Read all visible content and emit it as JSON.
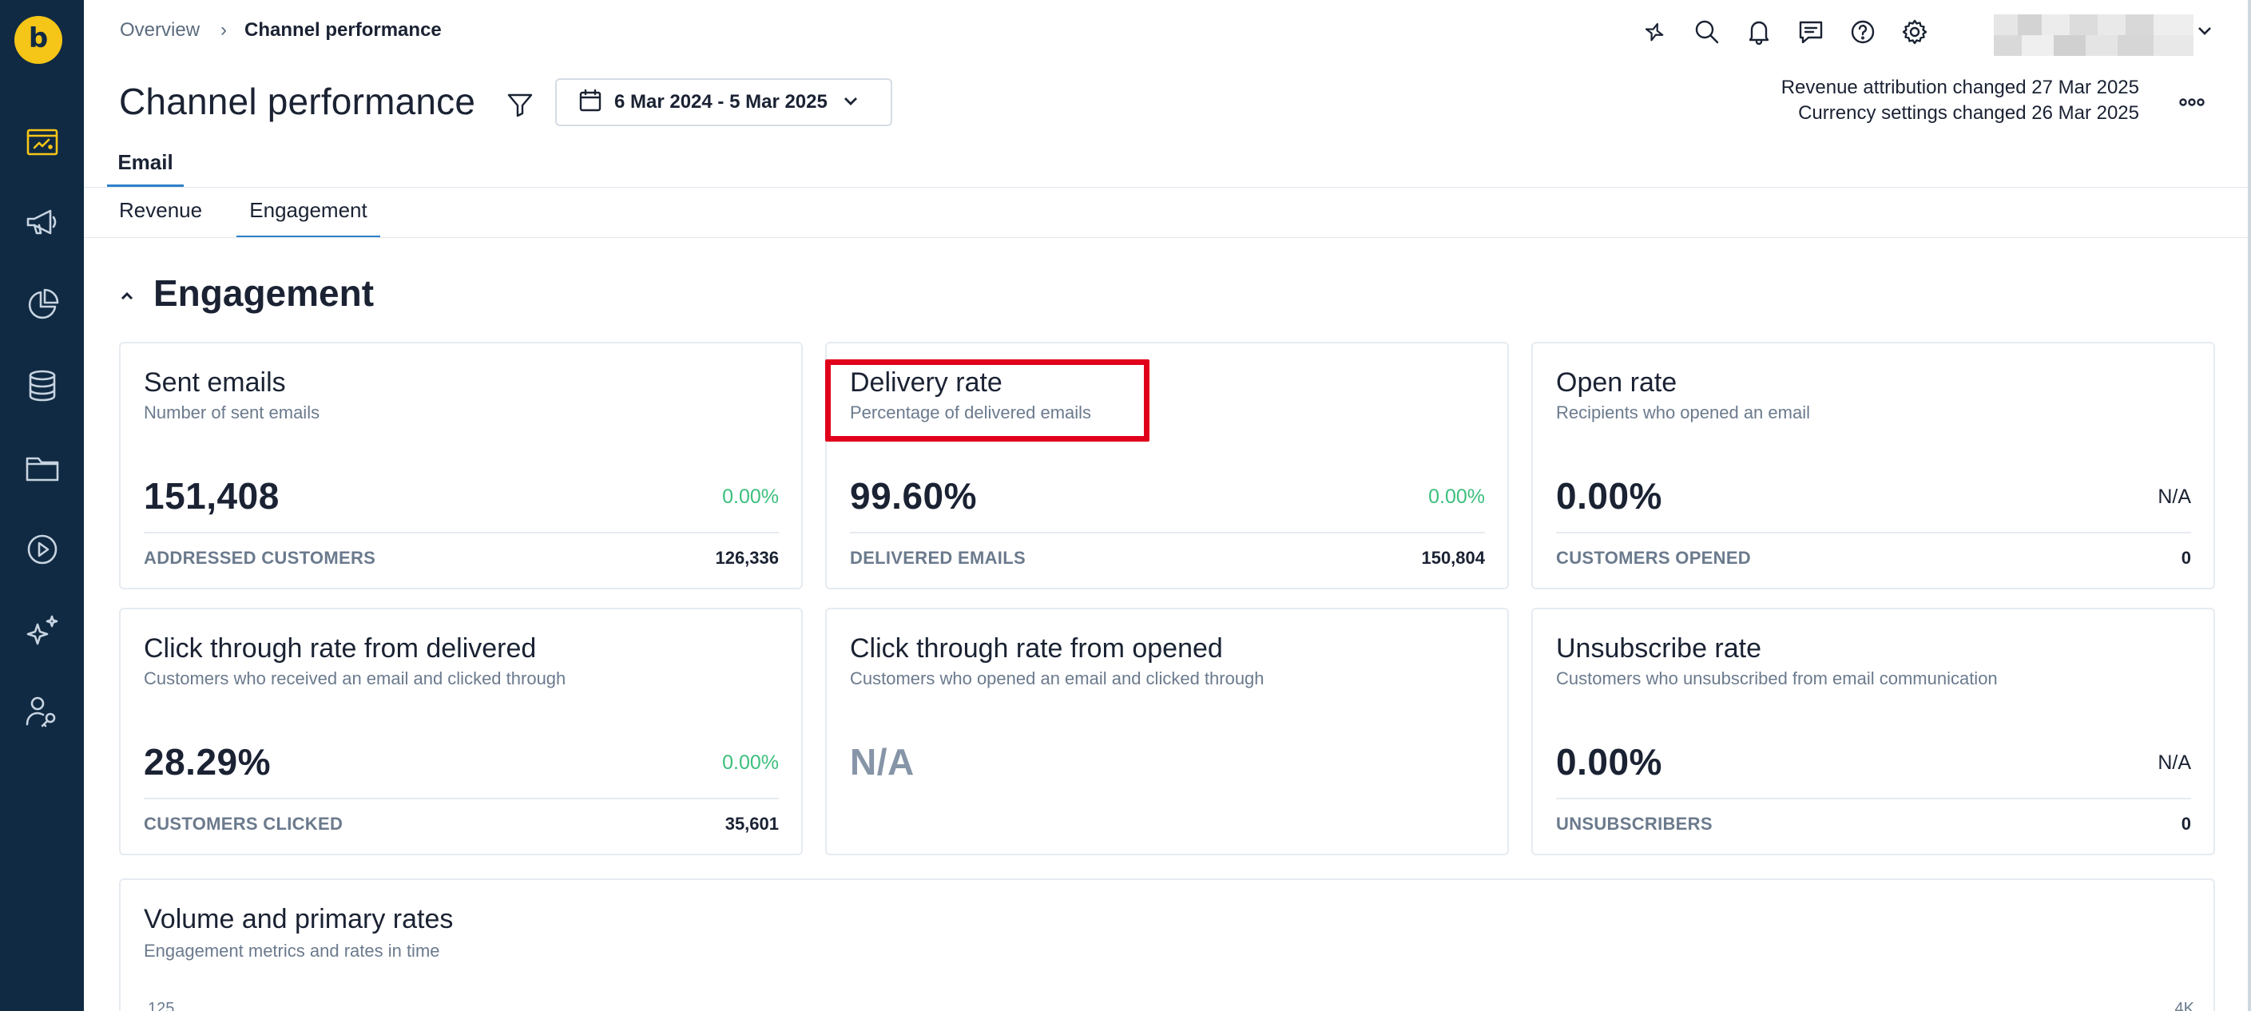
{
  "app": {
    "logo_letter": "b"
  },
  "sidebar": {
    "items": [
      {
        "name": "dashboards",
        "icon": "dashboard-icon",
        "active": true
      },
      {
        "name": "campaigns",
        "icon": "megaphone-icon"
      },
      {
        "name": "analyses",
        "icon": "pie-chart-icon"
      },
      {
        "name": "data",
        "icon": "database-icon"
      },
      {
        "name": "assets",
        "icon": "folder-icon"
      },
      {
        "name": "scenarios",
        "icon": "play-circle-icon"
      },
      {
        "name": "ai",
        "icon": "sparkles-icon"
      },
      {
        "name": "access",
        "icon": "user-key-icon"
      }
    ]
  },
  "breadcrumb": {
    "parent": "Overview",
    "current": "Channel performance"
  },
  "topbar_icons": [
    "ai-assistant-icon",
    "search-icon",
    "bell-icon",
    "chat-icon",
    "help-icon",
    "gear-icon"
  ],
  "header": {
    "title": "Channel performance",
    "date_range": "6 Mar 2024 - 5 Mar 2025",
    "notes": [
      "Revenue attribution changed 27 Mar 2025",
      "Currency settings changed 26 Mar 2025"
    ]
  },
  "tabs": {
    "channel": "Email",
    "sub": [
      "Revenue",
      "Engagement"
    ],
    "active_sub": "Engagement"
  },
  "section": {
    "title": "Engagement"
  },
  "cards": [
    {
      "title": "Sent emails",
      "subtitle": "Number of sent emails",
      "value": "151,408",
      "change": "0.00%",
      "footer_label": "ADDRESSED CUSTOMERS",
      "footer_value": "126,336"
    },
    {
      "title": "Delivery rate",
      "subtitle": "Percentage of delivered emails",
      "value": "99.60%",
      "change": "0.00%",
      "footer_label": "DELIVERED EMAILS",
      "footer_value": "150,804"
    },
    {
      "title": "Open rate",
      "subtitle": "Recipients who opened an email",
      "value": "0.00%",
      "change": "N/A",
      "footer_label": "CUSTOMERS OPENED",
      "footer_value": "0"
    },
    {
      "title": "Click through rate from delivered",
      "subtitle": "Customers who received an email and clicked through",
      "value": "28.29%",
      "change": "0.00%",
      "footer_label": "CUSTOMERS CLICKED",
      "footer_value": "35,601"
    },
    {
      "title": "Click through rate from opened",
      "subtitle": "Customers who opened an email and clicked through",
      "value": "N/A"
    },
    {
      "title": "Unsubscribe rate",
      "subtitle": "Customers who unsubscribed from email communication",
      "value": "0.00%",
      "change": "N/A",
      "footer_label": "UNSUBSCRIBERS",
      "footer_value": "0"
    }
  ],
  "chart_card": {
    "title": "Volume and primary rates",
    "subtitle": "Engagement metrics and rates in time",
    "left_axis_top": "125",
    "right_axis_top": "4K"
  },
  "colors": {
    "sidebar_bg": "#102a43",
    "accent_yellow": "#f5c518",
    "positive_green": "#3cbf7d",
    "tab_underline": "#2f80c8",
    "highlight_red": "#e0001b"
  }
}
